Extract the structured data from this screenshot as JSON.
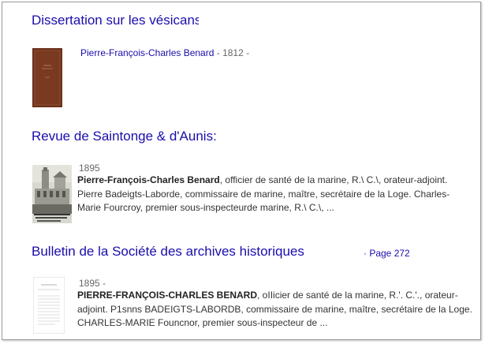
{
  "results": [
    {
      "title": "Dissertation sur les vésicans",
      "author": "Pierre-François-Charles Benard",
      "year_suffix": " - 1812 -"
    },
    {
      "title": "Revue de Saintonge & d'Aunis:",
      "year": "1895",
      "snippet_bold": "Pierre-François-Charles Benard",
      "snippet_rest": ", officier de santé de la marine, R.\\ C.\\, orateur-adjoint. Pierre Badeigts-Laborde, commissaire de marine, maître, secrétaire de la Loge. Charles-Marie Fourcroy, premier sous-inspecteurde marine, R.\\ C.\\, ..."
    },
    {
      "title": "Bulletin de la Société des archives historiques",
      "page_link": "· Page 272",
      "year": "1895 -",
      "snippet_bold": "PIERRE-FRANÇOIS-CHARLES BENARD",
      "snippet_rest": ", oIIicier de santé de la marine, R.'. C.'., orateur-adjoint. P1snns BADEIGTS-LABORDB, commissaire de marine, maître, secrétaire de la Loge. CHARLES-MARIE Founcnor, premier sous-inspecteur de ..."
    }
  ],
  "colors": {
    "link": "#1a0dab",
    "text": "#333333",
    "meta": "#666666",
    "book_cover": "#7a3a22"
  }
}
